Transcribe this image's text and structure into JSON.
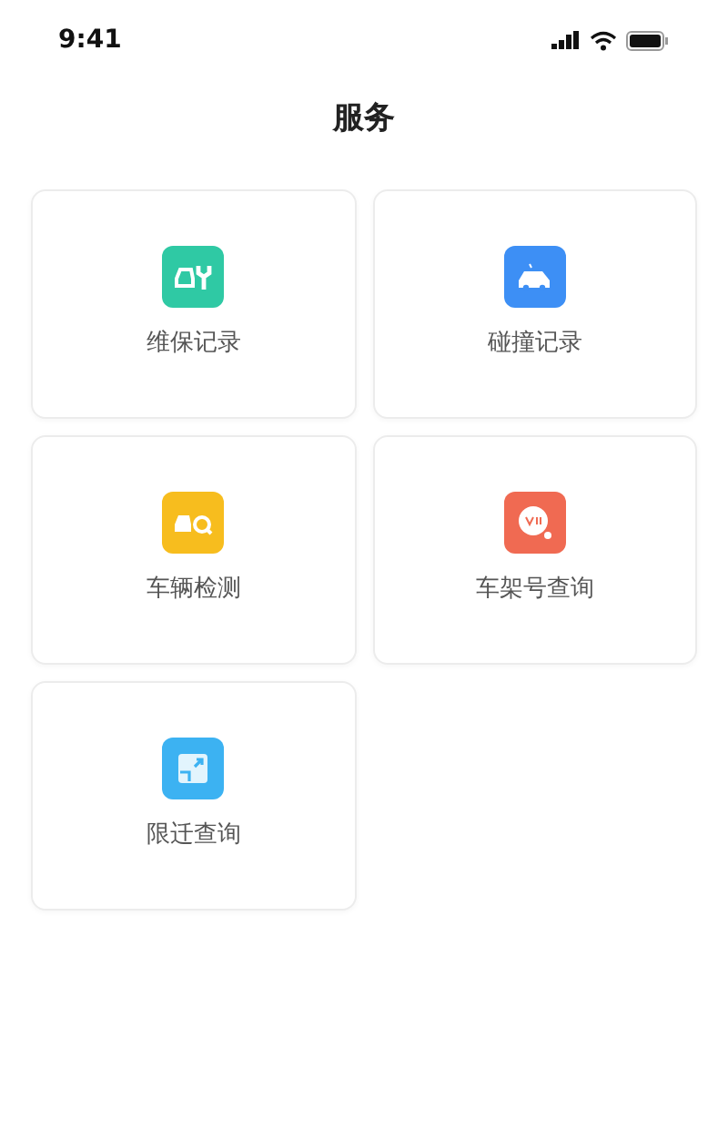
{
  "status_bar": {
    "time": "9:41"
  },
  "title": "服务",
  "services": [
    {
      "label": "维保记录",
      "kind": "maintenance",
      "color": "#2fc9a4"
    },
    {
      "label": "碰撞记录",
      "kind": "collision",
      "color": "#3d8ff5"
    },
    {
      "label": "车辆检测",
      "kind": "inspection",
      "color": "#f7bd1e"
    },
    {
      "label": "车架号查询",
      "kind": "vin",
      "color": "#f06a52"
    },
    {
      "label": "限迁查询",
      "kind": "relocation",
      "color": "#3cb2f2"
    }
  ]
}
